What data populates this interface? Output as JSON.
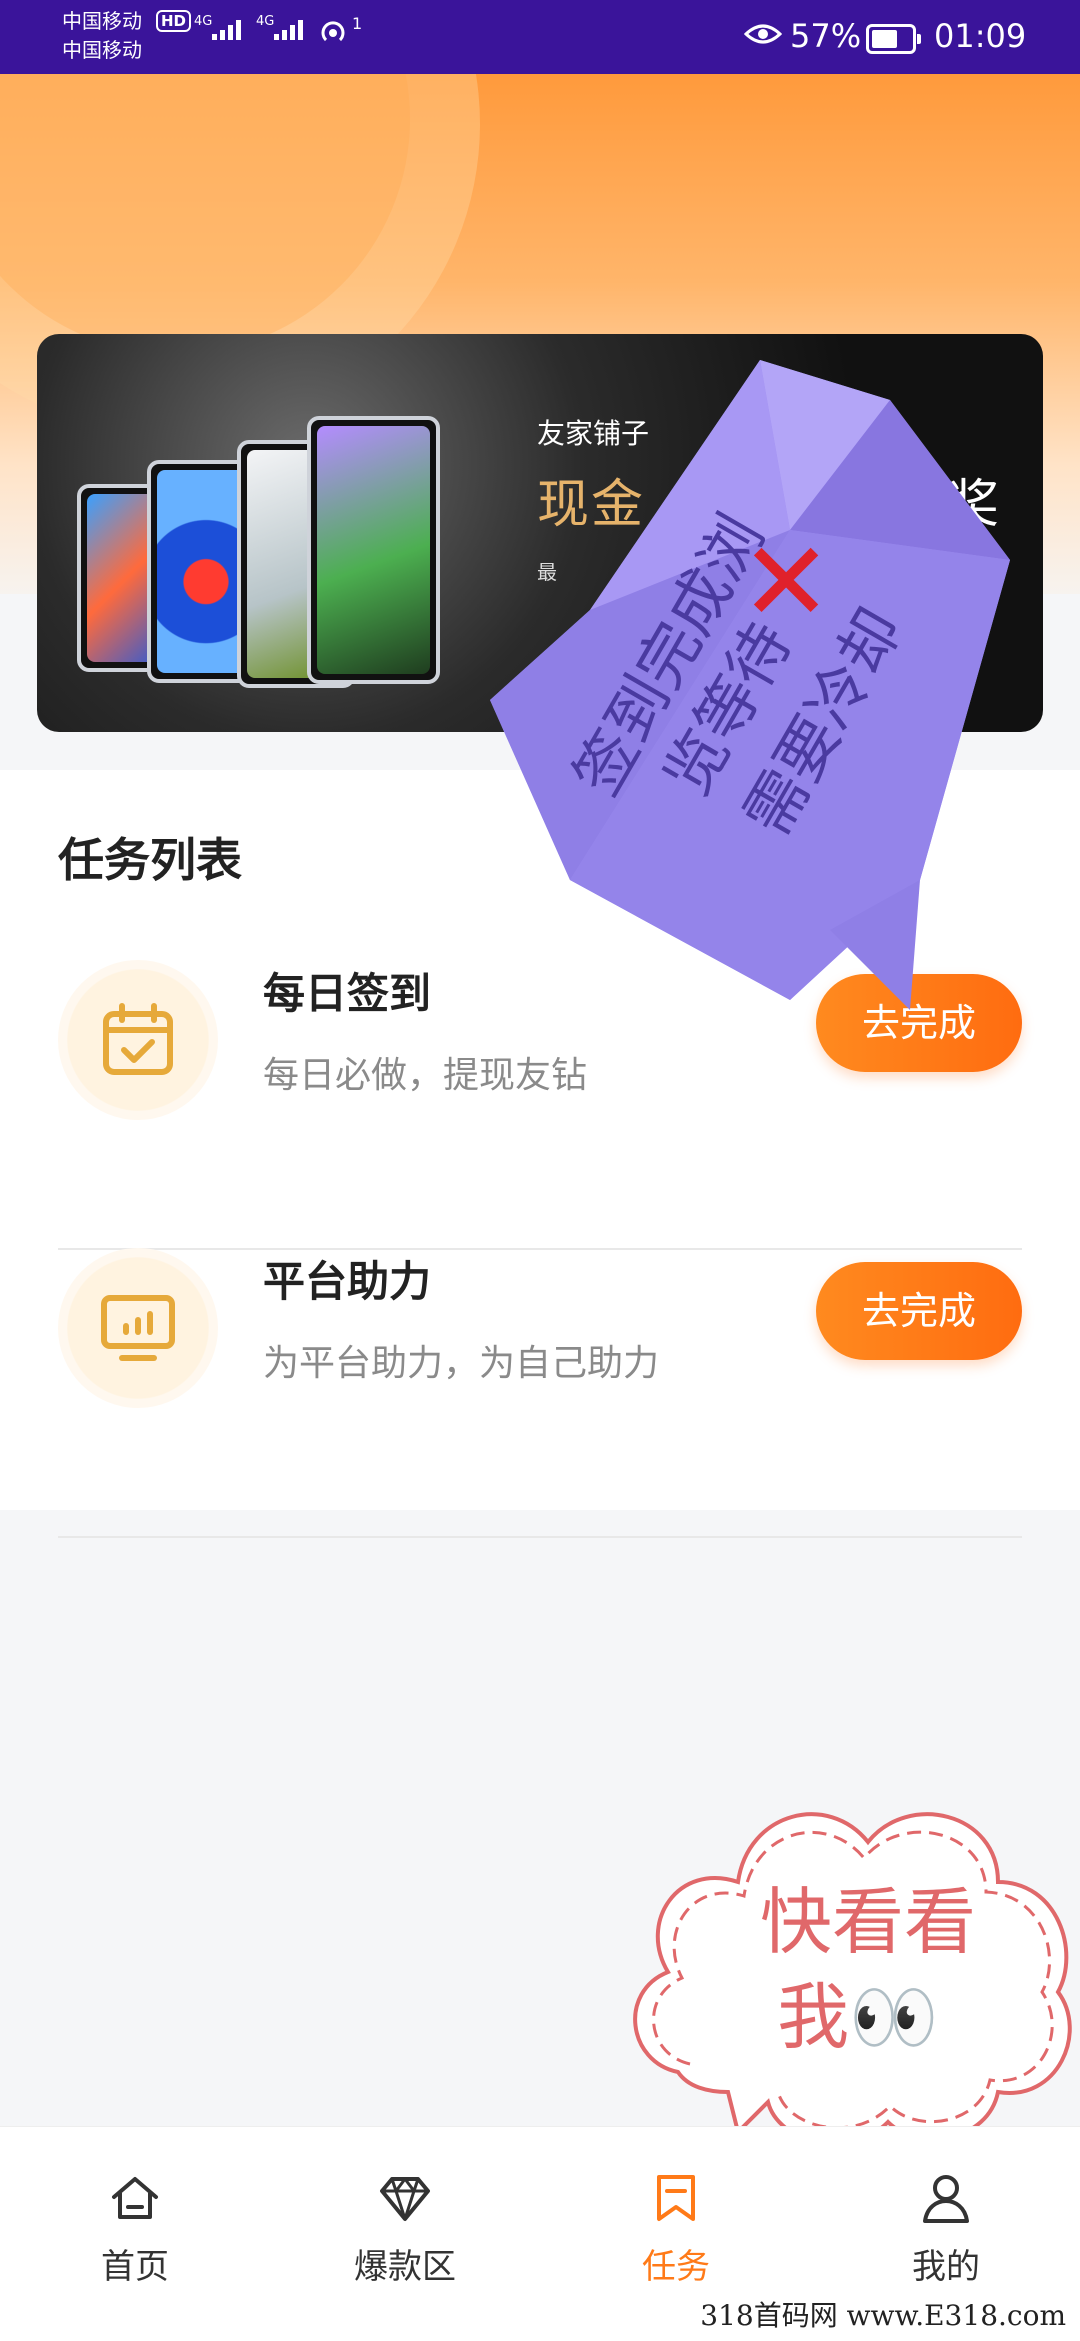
{
  "status_bar": {
    "carrier_1": "中国移动",
    "carrier_2": "中国移动",
    "hd": "HD",
    "net_1": "4G",
    "net_2": "4G",
    "hotspot_count": "1",
    "battery": "57%",
    "battery_level": 57,
    "time": "01:09"
  },
  "banner": {
    "subtitle": "友家铺子",
    "title": "现金",
    "title_end": "奖",
    "note": "最"
  },
  "tasks": {
    "heading": "任务列表",
    "items": [
      {
        "title": "每日签到",
        "desc": "每日必做，提现友钻",
        "button": "去完成",
        "icon": "calendar-check-icon"
      },
      {
        "title": "平台助力",
        "desc": "为平台助力，为自己助力",
        "button": "去完成",
        "icon": "monitor-chart-icon"
      }
    ]
  },
  "annotation": {
    "col_1": "签到完成浏",
    "col_2": "览等待",
    "col_3": "需要冷却",
    "mark": "✕",
    "color": "#8f7fe6"
  },
  "cloud": {
    "line_1": "快看看",
    "line_2": "我👀",
    "color": "#e0686a"
  },
  "nav": {
    "items": [
      {
        "label": "首页",
        "icon": "home-icon"
      },
      {
        "label": "爆款区",
        "icon": "diamond-icon"
      },
      {
        "label": "任务",
        "icon": "bookmark-icon",
        "active": true
      },
      {
        "label": "我的",
        "icon": "user-icon"
      }
    ],
    "active_color": "#ff7a18"
  },
  "watermark": "318首码网 www.E318.com"
}
